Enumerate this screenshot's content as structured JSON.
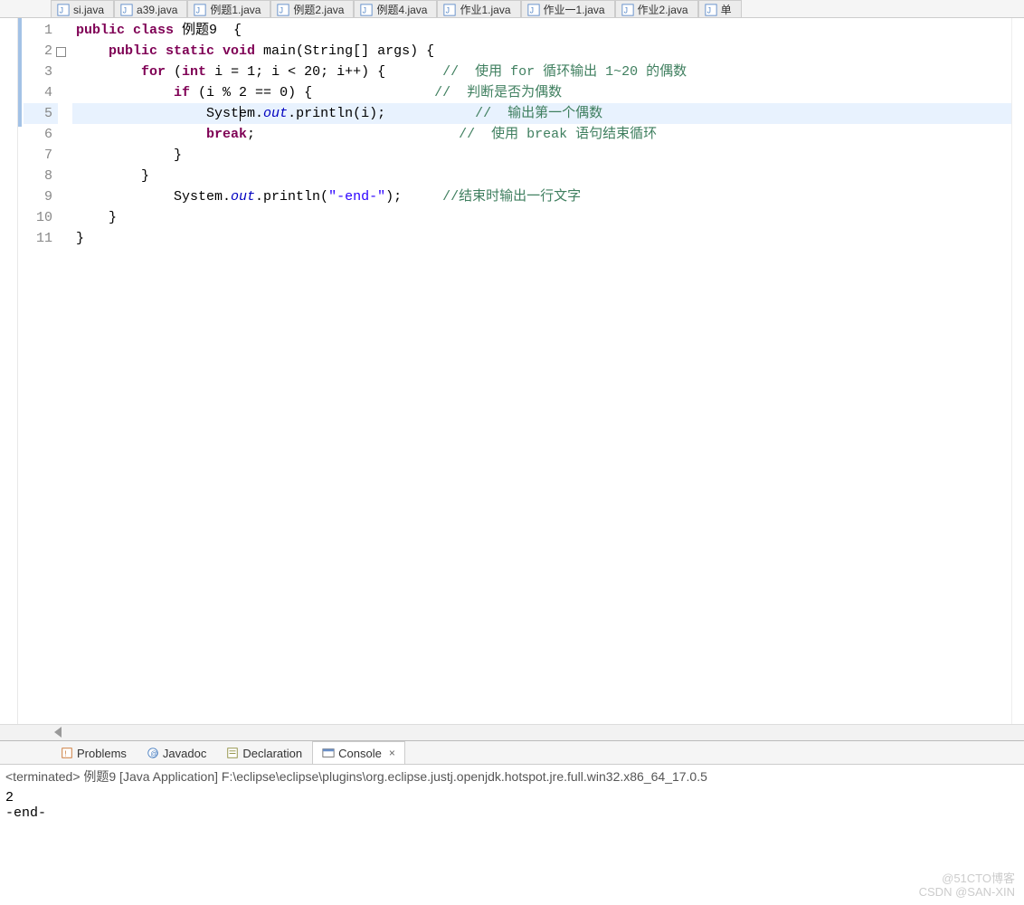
{
  "tabs": [
    {
      "label": "si.java"
    },
    {
      "label": "a39.java"
    },
    {
      "label": "例题1.java"
    },
    {
      "label": "例题2.java"
    },
    {
      "label": "例题4.java"
    },
    {
      "label": "作业1.java"
    },
    {
      "label": "作业一1.java"
    },
    {
      "label": "作业2.java"
    },
    {
      "label": "单"
    }
  ],
  "lineNumbers": [
    "1",
    "2",
    "3",
    "4",
    "5",
    "6",
    "7",
    "8",
    "9",
    "10",
    "11"
  ],
  "code": {
    "l1": {
      "a": "public class",
      "b": " 例题9  {"
    },
    "l2": {
      "a": "    ",
      "b": "public static void",
      "c": " main(String[] args) {"
    },
    "l3": {
      "a": "        ",
      "b": "for",
      "c": " (",
      "d": "int",
      "e": " i = 1; i < 20; i++) {       ",
      "f": "//  使用 for 循环输出 1~20 的偶数"
    },
    "l4": {
      "a": "            ",
      "b": "if",
      "c": " (i % 2 == 0) {               ",
      "d": "//  判断是否为偶数"
    },
    "l5": {
      "a": "                System.",
      "b": "out",
      "c": ".println(i);           ",
      "d": "//  输出第一个偶数"
    },
    "l6": {
      "a": "                ",
      "b": "break",
      "c": ";                         ",
      "d": "//  使用 break 语句结束循环"
    },
    "l7": {
      "a": "            }"
    },
    "l8": {
      "a": "        }"
    },
    "l9": {
      "a": "            System.",
      "b": "out",
      "c": ".println(",
      "d": "\"-end-\"",
      "e": ");     ",
      "f": "//结束时输出一行文字"
    },
    "l10": {
      "a": "    }"
    },
    "l11": {
      "a": "}"
    }
  },
  "bottomTabs": {
    "problems": "Problems",
    "javadoc": "Javadoc",
    "declaration": "Declaration",
    "console": "Console"
  },
  "statusLine": "<terminated> 例题9 [Java Application] F:\\eclipse\\eclipse\\plugins\\org.eclipse.justj.openjdk.hotspot.jre.full.win32.x86_64_17.0.5",
  "consoleOutput": "2\n-end-",
  "watermark1": "@51CTO博客",
  "watermark2": "CSDN @SAN-XIN"
}
